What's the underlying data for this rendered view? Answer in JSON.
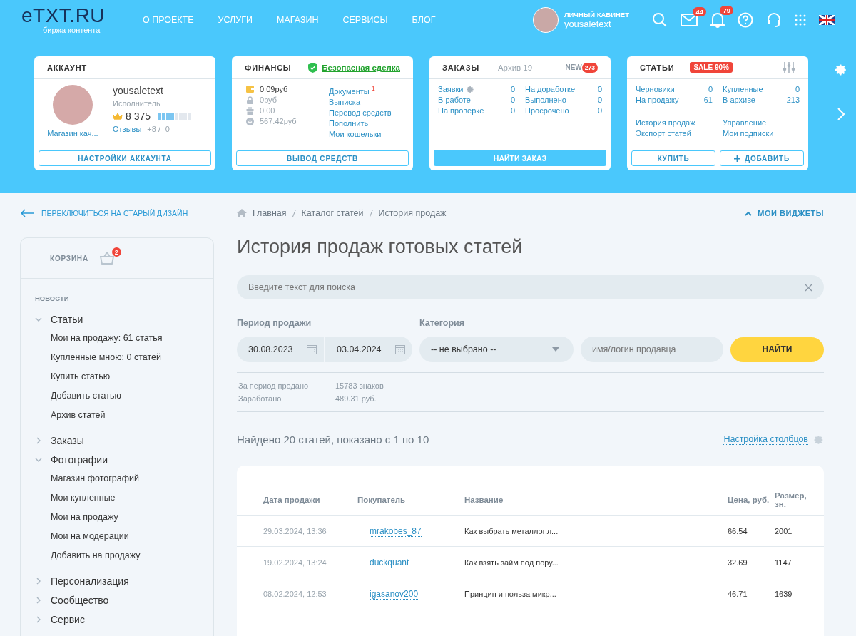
{
  "header": {
    "logo": "eTXT.RU",
    "tagline": "биржа контента",
    "nav": [
      "О ПРОЕКТЕ",
      "УСЛУГИ",
      "МАГАЗИН",
      "СЕРВИСЫ",
      "БЛОГ"
    ],
    "cabinet_label": "ЛИЧНЫЙ КАБИНЕТ",
    "username": "yousaletext",
    "mail_count": "44",
    "notify_count": "79"
  },
  "widgets": {
    "account": {
      "title": "АККАУНТ",
      "name": "yousaletext",
      "role": "Исполнитель",
      "rating": "8 375",
      "level": 0.5,
      "shop_link": "Магазин кач...",
      "reviews_link": "Отзывы",
      "reviews": "+8 / -0",
      "button": "НАСТРОЙКИ АККАУНТА"
    },
    "finance": {
      "title": "ФИНАНСЫ",
      "safe_deal": "Безопасная сделка",
      "balances": [
        {
          "kind": "wallet",
          "value": "0.09",
          "unit": "руб"
        },
        {
          "kind": "lock",
          "value": "0",
          "unit": "руб"
        },
        {
          "kind": "gift",
          "value": "0.00"
        },
        {
          "kind": "download",
          "value": "567.42",
          "unit": "руб"
        }
      ],
      "links": [
        {
          "label": "Документы",
          "count": "1"
        },
        {
          "label": "Выписка"
        },
        {
          "label": "Перевод средств"
        },
        {
          "label": "Пополнить"
        },
        {
          "label": "Мои кошельки"
        }
      ],
      "button": "ВЫВОД СРЕДСТВ"
    },
    "orders": {
      "title": "ЗАКАЗЫ",
      "archive": "Архив 19",
      "new_label": "NEW",
      "new_count": "273",
      "stats": [
        {
          "label": "Заявки",
          "value": "0",
          "gear": true
        },
        {
          "label": "На доработке",
          "value": "0",
          "gear": false
        },
        {
          "label": "В работе",
          "value": "0",
          "gear": false
        },
        {
          "label": "Выполнено",
          "value": "0",
          "gear": false
        },
        {
          "label": "На проверке",
          "value": "0",
          "gear": false
        },
        {
          "label": "Просрочено",
          "value": "0",
          "gear": false
        }
      ],
      "button": "НАЙТИ ЗАКАЗ"
    },
    "articles": {
      "title": "СТАТЬИ",
      "sale": "SALE 90%",
      "stats": [
        {
          "label": "Черновики",
          "value": "0"
        },
        {
          "label": "Купленные",
          "value": "0"
        },
        {
          "label": "На продажу",
          "value": "61"
        },
        {
          "label": "В архиве",
          "value": "213"
        }
      ],
      "links": [
        "История продаж",
        "Управление",
        "Экспорт статей",
        "Мои подписки"
      ],
      "buy_button": "КУПИТЬ",
      "add_button": "ДОБАВИТЬ"
    }
  },
  "sidebar": {
    "switch_link": "ПЕРЕКЛЮЧИТЬСЯ НА СТАРЫЙ ДИЗАЙН",
    "cart_label": "КОРЗИНА",
    "cart_count": "2",
    "section": "НОВОСТИ",
    "groups": [
      {
        "label": "Статьи",
        "expanded": true,
        "children": [
          "Мои на продажу: 61 статья",
          "Купленные мною: 0 статей",
          "Купить статью",
          "Добавить статью",
          "Архив статей"
        ]
      },
      {
        "label": "Заказы",
        "expanded": false
      },
      {
        "label": "Фотографии",
        "expanded": true,
        "children": [
          "Магазин фотографий",
          "Мои купленные",
          "Мои на продажу",
          "Мои на модерации",
          "Добавить на продажу"
        ]
      },
      {
        "label": "Персонализация",
        "expanded": false
      },
      {
        "label": "Сообщество",
        "expanded": false
      },
      {
        "label": "Сервис",
        "expanded": false
      }
    ]
  },
  "main": {
    "breadcrumbs": [
      "Главная",
      "Каталог статей",
      "История продаж"
    ],
    "widgets_toggle": "МОИ ВИДЖЕТЫ",
    "title": "История продаж готовых статей",
    "search": {
      "placeholder": "Введите текст для поиска"
    },
    "filters": {
      "period_label": "Период продажи",
      "date_from": "30.08.2023",
      "date_to": "03.04.2024",
      "category_label": "Категория",
      "category": "-- не выбрано --",
      "seller_placeholder": "имя/логин продавца",
      "button": "НАЙТИ"
    },
    "summary": [
      {
        "label": "За период продано",
        "value": "15783 знаков"
      },
      {
        "label": "Заработано",
        "value": "489.31 руб."
      }
    ],
    "found": "Найдено 20 статей, показано с 1 по 10",
    "columns_link": "Настройка столбцов",
    "table": {
      "columns": [
        "Дата продажи",
        "Покупатель",
        "Название",
        "Цена, руб.",
        "Размер, зн."
      ],
      "rows": [
        [
          "29.03.2024, 13:36",
          "mrakobes_87",
          "Как выбрать металлопл...",
          "66.54",
          "2001"
        ],
        [
          "19.02.2024, 13:24",
          "duckquant",
          "Как взять займ под пору...",
          "32.69",
          "1147"
        ],
        [
          "08.02.2024, 12:53",
          "igasanov200",
          "Принцип и польза микр...",
          "46.71",
          "1639"
        ]
      ]
    }
  }
}
